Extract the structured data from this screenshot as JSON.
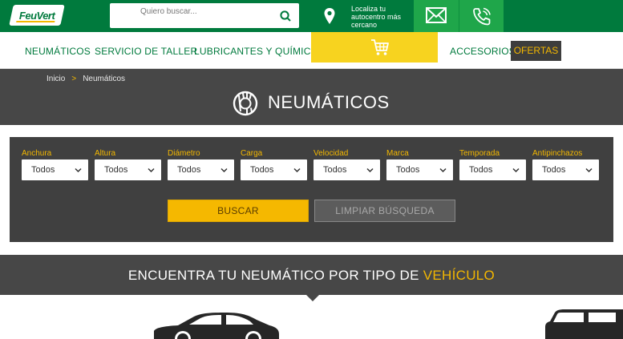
{
  "header": {
    "logo_text": "FeuVert",
    "search_placeholder": "Quiero buscar...",
    "locator_text": "Localiza tu autocentro más cercano"
  },
  "nav": {
    "items": [
      "NEUMÁTICOS",
      "SERVICIO DE TALLER",
      "LUBRICANTES Y QUÍMICOS",
      "ACCESORIOS"
    ],
    "ofertas": "OFERTAS"
  },
  "breadcrumb": {
    "home": "Inicio",
    "separator": ">",
    "current": "Neumáticos"
  },
  "hero": {
    "title": "NEUMÁTICOS"
  },
  "filters": [
    {
      "label": "Anchura",
      "value": "Todos"
    },
    {
      "label": "Altura",
      "value": "Todos"
    },
    {
      "label": "Diámetro",
      "value": "Todos"
    },
    {
      "label": "Carga",
      "value": "Todos"
    },
    {
      "label": "Velocidad",
      "value": "Todos"
    },
    {
      "label": "Marca",
      "value": "Todos"
    },
    {
      "label": "Temporada",
      "value": "Todos"
    },
    {
      "label": "Antipinchazos",
      "value": "Todos"
    }
  ],
  "actions": {
    "search": "BUSCAR",
    "clear": "LIMPIAR BÚSQUEDA"
  },
  "vehicle_section": {
    "title_main": "ENCUENTRA TU NEUMÁTICO POR TIPO DE ",
    "title_accent": "VEHÍCULO"
  },
  "colors": {
    "brand_green": "#007a3d",
    "accent_yellow": "#f3b700",
    "dark_gray": "#474747"
  }
}
